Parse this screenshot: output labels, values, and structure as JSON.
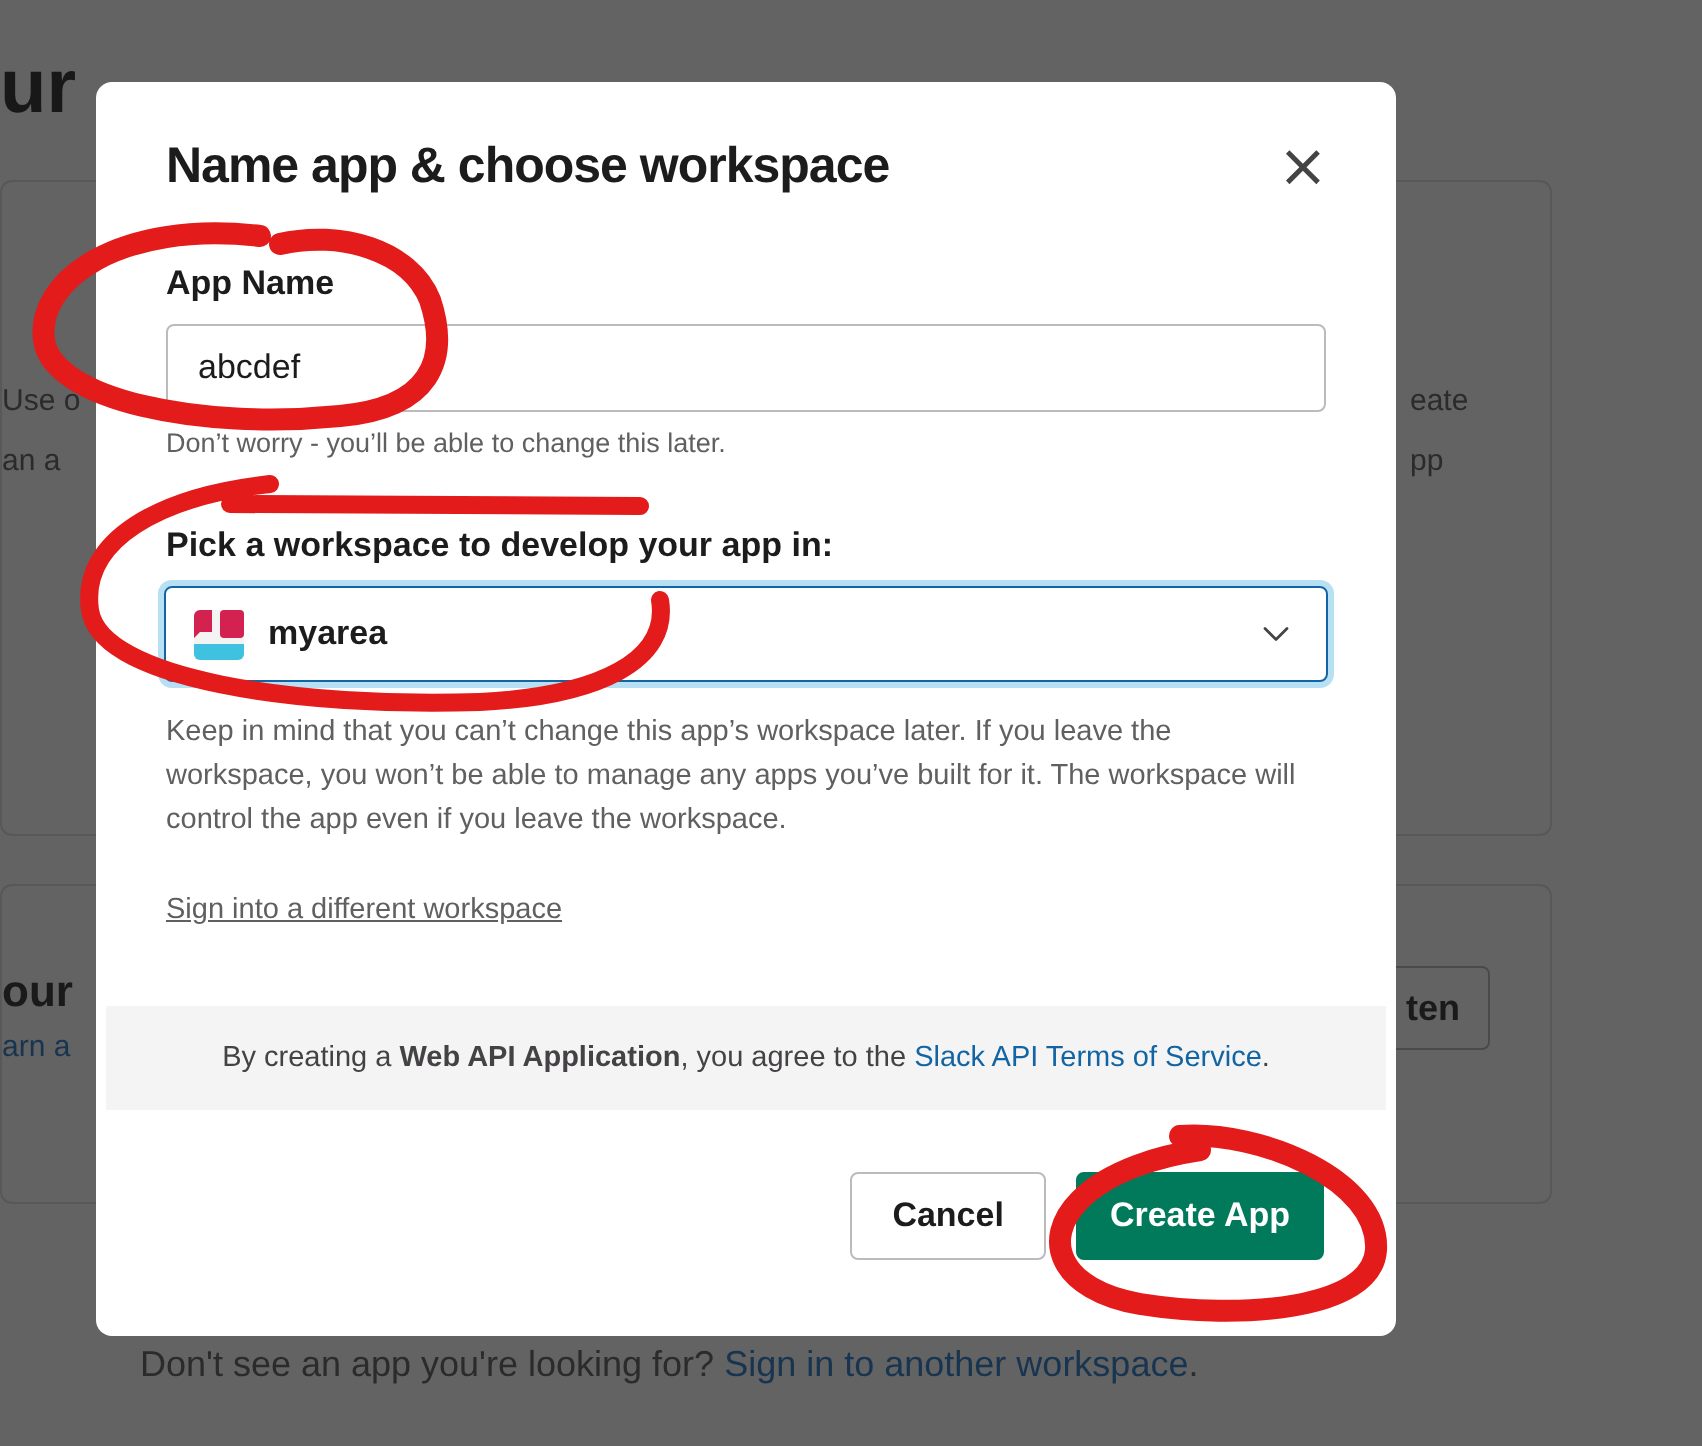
{
  "background": {
    "heading": "ur",
    "cards": [
      {
        "left_lines": [
          "Use o",
          "an a"
        ],
        "right_lines": [
          "eate",
          "pp"
        ]
      },
      {
        "title": "our",
        "link": "arn a",
        "button": "ten"
      }
    ],
    "footer_text": "Don't see an app you're looking for?",
    "footer_link": "Sign in to another workspace",
    "footer_end": "."
  },
  "dialog": {
    "title": "Name app & choose workspace",
    "close_label": "×",
    "app_name": {
      "label": "App Name",
      "value": "abcdef",
      "hint": "Don’t worry - you’ll be able to change this later."
    },
    "workspace": {
      "label": "Pick a workspace to develop your app in:",
      "value": "myarea",
      "focused": true,
      "help": "Keep in mind that you can’t change this app’s workspace later. If you leave the workspace, you won’t be able to manage any apps you’ve built for it. The workspace will control the app even if you leave the workspace.",
      "link": "Sign into a different workspace"
    },
    "notice": {
      "text": "By creating a **Web API Application**, you agree to the ",
      "link": "Slack API Terms of Service",
      "end": "."
    },
    "buttons": [
      {
        "label": "Cancel",
        "kind": "secondary"
      },
      {
        "label": "Create App",
        "kind": "primary"
      }
    ]
  }
}
